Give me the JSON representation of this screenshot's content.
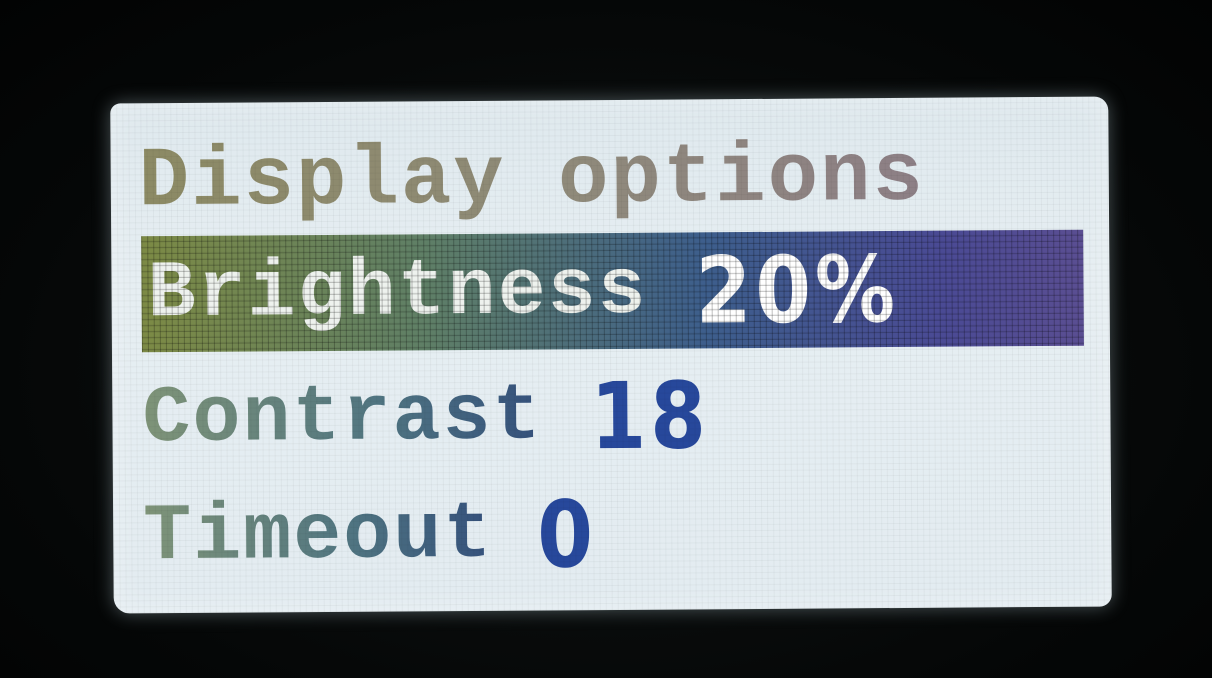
{
  "menu": {
    "title": "Display options",
    "items": [
      {
        "label": "Brightness",
        "value": "20%",
        "selected": true
      },
      {
        "label": "Contrast",
        "value": "18",
        "selected": false
      },
      {
        "label": "Timeout",
        "value": "0",
        "selected": false
      }
    ]
  },
  "colors": {
    "screen_background": "#e3ecf1",
    "bezel": "#060808",
    "highlight_start": "#7c8a45",
    "highlight_end": "#5a4e92",
    "value_text": "#27489b",
    "title_text": "#9a9477"
  }
}
